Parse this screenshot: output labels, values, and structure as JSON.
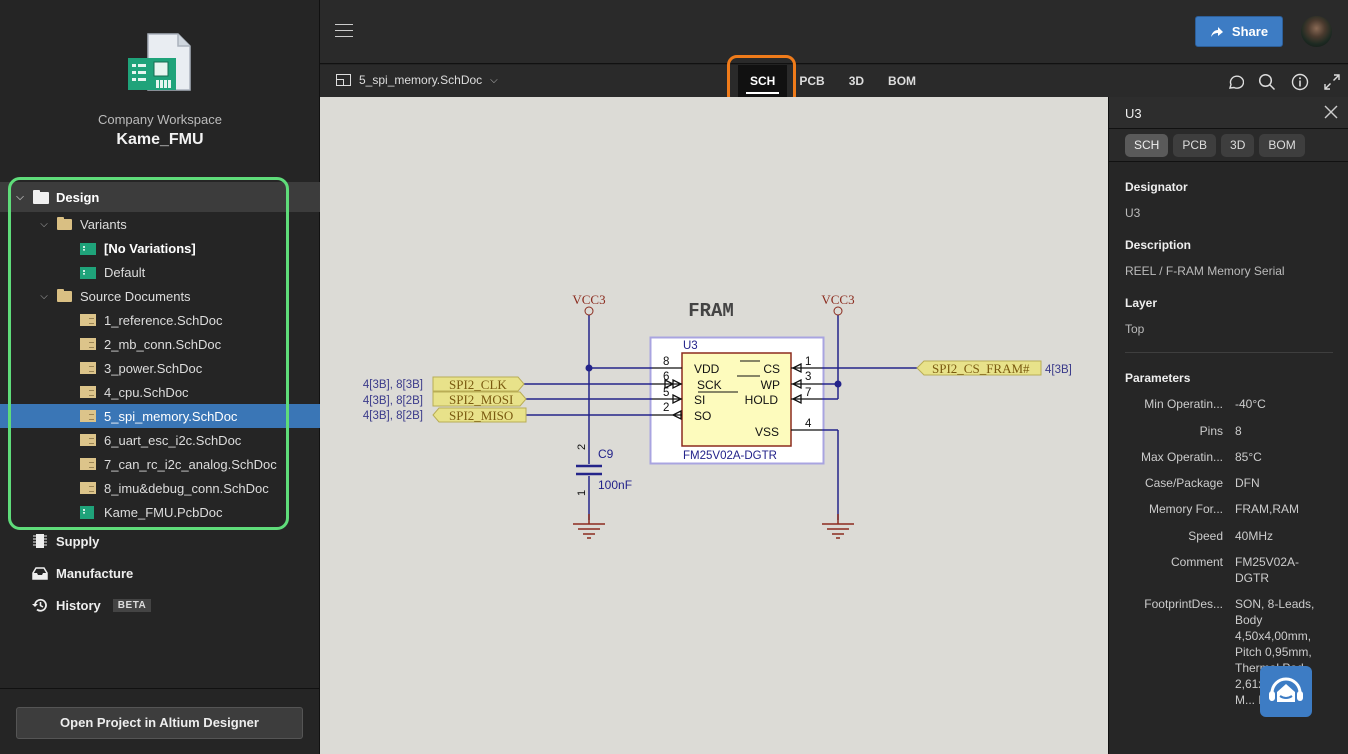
{
  "workspace": {
    "label": "Company Workspace",
    "project": "Kame_FMU"
  },
  "tree": {
    "design": "Design",
    "variants": "Variants",
    "variant_items": [
      "[No Variations]",
      "Default"
    ],
    "source_documents": "Source Documents",
    "documents": [
      "1_reference.SchDoc",
      "2_mb_conn.SchDoc",
      "3_power.SchDoc",
      "4_cpu.SchDoc",
      "5_spi_memory.SchDoc",
      "6_uart_esc_i2c.SchDoc",
      "7_can_rc_i2c_analog.SchDoc",
      "8_imu&debug_conn.SchDoc"
    ],
    "pcb_document": "Kame_FMU.PcbDoc",
    "selected_document": "5_spi_memory.SchDoc"
  },
  "nav": {
    "supply": "Supply",
    "manufacture": "Manufacture",
    "history": "History",
    "history_badge": "BETA"
  },
  "open_project_button": "Open Project in Altium Designer",
  "topbar": {
    "share_label": "Share"
  },
  "docbar": {
    "current_document": "5_spi_memory.SchDoc",
    "tabs": [
      "SCH",
      "PCB",
      "3D",
      "BOM"
    ],
    "active_tab": "SCH"
  },
  "schematic": {
    "title": "FRAM",
    "component": {
      "designator": "U3",
      "part": "FM25V02A-DGTR",
      "left_pins": [
        {
          "num": "8",
          "name": "VDD"
        },
        {
          "num": "6",
          "name": "SCK"
        },
        {
          "num": "5",
          "name": "SI"
        },
        {
          "num": "2",
          "name": "SO"
        }
      ],
      "right_pins": [
        {
          "num": "1",
          "name": "CS"
        },
        {
          "num": "3",
          "name": "WP"
        },
        {
          "num": "7",
          "name": "HOLD"
        },
        {
          "num": "4",
          "name": "VSS"
        }
      ]
    },
    "power_ports": [
      "VCC3",
      "VCC3"
    ],
    "net_labels": [
      {
        "name": "SPI2_CLK",
        "refs": "4[3B], 8[3B]"
      },
      {
        "name": "SPI2_MOSI",
        "refs": "4[3B], 8[2B]"
      },
      {
        "name": "SPI2_MISO",
        "refs": "4[3B], 8[2B]"
      },
      {
        "name": "SPI2_CS_FRAM#",
        "refs": "4[3B]"
      }
    ],
    "capacitor": {
      "designator": "C9",
      "value": "100nF",
      "pin_top": "2",
      "pin_bottom": "1"
    }
  },
  "panel": {
    "title": "U3",
    "tabs": [
      "SCH",
      "PCB",
      "3D",
      "BOM"
    ],
    "active_tab": "SCH",
    "designator_label": "Designator",
    "designator": "U3",
    "description_label": "Description",
    "description": "REEL / F-RAM Memory Serial",
    "layer_label": "Layer",
    "layer": "Top",
    "parameters_label": "Parameters",
    "parameters": [
      {
        "key": "Min Operatin...",
        "value": "-40°C"
      },
      {
        "key": "Pins",
        "value": "8"
      },
      {
        "key": "Max Operatin...",
        "value": "85°C"
      },
      {
        "key": "Case/Package",
        "value": "DFN"
      },
      {
        "key": "Memory For...",
        "value": "FRAM,RAM"
      },
      {
        "key": "Speed",
        "value": "40MHz"
      },
      {
        "key": "Comment",
        "value": "FM25V02A-DGTR"
      },
      {
        "key": "FootprintDes...",
        "value": "SON, 8-Leads, Body 4,50x4,00mm, Pitch 0,95mm, Thermal Pad 2,61x... IPC M... Density"
      }
    ]
  },
  "colors": {
    "accent": "#3d7cc4",
    "highlight_green": "#5fdc7a",
    "highlight_orange": "#ef7b1a",
    "wire": "#24248a",
    "net_label_fill": "#e8e28a"
  }
}
